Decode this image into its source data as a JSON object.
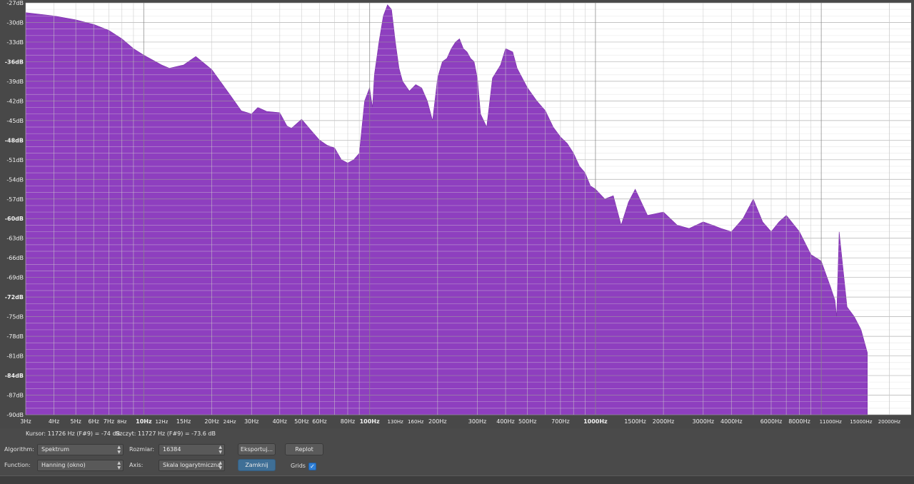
{
  "plot": {
    "db_labels": [
      "-27dB",
      "-30dB",
      "-33dB",
      "-36dB",
      "-39dB",
      "-42dB",
      "-45dB",
      "-48dB",
      "-51dB",
      "-54dB",
      "-57dB",
      "-60dB",
      "-63dB",
      "-66dB",
      "-69dB",
      "-72dB",
      "-75dB",
      "-78dB",
      "-81dB",
      "-84dB",
      "-87dB",
      "-90dB"
    ],
    "freq_labels": [
      "3Hz",
      "4Hz",
      "5Hz",
      "6Hz",
      "7Hz",
      "8Hz",
      "10Hz",
      "12Hz",
      "15Hz",
      "20Hz",
      "24Hz",
      "30Hz",
      "40Hz",
      "50Hz",
      "60Hz",
      "80Hz",
      "100Hz",
      "130Hz",
      "160Hz",
      "200Hz",
      "300Hz",
      "400Hz",
      "500Hz",
      "700Hz",
      "1000Hz",
      "1500Hz",
      "2000Hz",
      "3000Hz",
      "4000Hz",
      "6000Hz",
      "8000Hz",
      "11000Hz",
      "15000Hz",
      "20000Hz"
    ],
    "fill_color": "#8e3fbf",
    "background": "#ffffff"
  },
  "chart_data": {
    "type": "area",
    "x_scale": "log",
    "xlim": [
      3,
      25000
    ],
    "ylim": [
      -90,
      -27
    ],
    "grid": true,
    "xlabel": "",
    "ylabel": "",
    "x": [
      3,
      4,
      5,
      6,
      7,
      8,
      9,
      10,
      12,
      13,
      15,
      17,
      20,
      24,
      27,
      30,
      32,
      35,
      40,
      43,
      45,
      50,
      55,
      60,
      65,
      70,
      75,
      80,
      85,
      90,
      95,
      100,
      103,
      105,
      108,
      110,
      115,
      120,
      125,
      130,
      135,
      140,
      150,
      160,
      170,
      180,
      190,
      200,
      210,
      220,
      230,
      240,
      250,
      260,
      270,
      280,
      290,
      300,
      310,
      330,
      350,
      380,
      400,
      430,
      450,
      500,
      550,
      600,
      650,
      700,
      750,
      800,
      850,
      900,
      950,
      1000,
      1100,
      1200,
      1300,
      1400,
      1500,
      1700,
      2000,
      2300,
      2600,
      3000,
      3300,
      3600,
      4000,
      4500,
      5000,
      5500,
      6000,
      6500,
      7000,
      8000,
      9000,
      10000,
      11000,
      11500,
      11700,
      12000,
      13000,
      14000,
      15000,
      16000
    ],
    "y": [
      -28.5,
      -29.0,
      -29.6,
      -30.3,
      -31.2,
      -32.5,
      -34.0,
      -35.0,
      -36.5,
      -37.0,
      -36.5,
      -35.2,
      -37.2,
      -41.0,
      -43.5,
      -44.0,
      -43.0,
      -43.6,
      -43.8,
      -45.8,
      -46.2,
      -44.8,
      -46.5,
      -48.0,
      -48.8,
      -49.2,
      -51.0,
      -51.5,
      -51.0,
      -50.0,
      -42.0,
      -40.0,
      -43.0,
      -38.0,
      -35.0,
      -33.0,
      -29.0,
      -27.3,
      -28.0,
      -33.0,
      -37.0,
      -39.0,
      -40.5,
      -39.5,
      -40.0,
      -42.0,
      -45.0,
      -38.5,
      -36.0,
      -35.5,
      -34.0,
      -33.0,
      -32.5,
      -34.0,
      -34.5,
      -35.5,
      -36.0,
      -38.5,
      -44.0,
      -46.0,
      -38.5,
      -36.5,
      -34.0,
      -34.5,
      -37.0,
      -40.0,
      -42.0,
      -43.5,
      -46.0,
      -47.5,
      -48.5,
      -50.0,
      -52.0,
      -53.0,
      -55.0,
      -55.5,
      -57.0,
      -56.5,
      -61.0,
      -57.5,
      -55.5,
      -59.5,
      -59.0,
      -61.0,
      -61.5,
      -60.5,
      -61.0,
      -61.5,
      -62.0,
      -60.0,
      -57.0,
      -60.5,
      -62.0,
      -60.5,
      -59.5,
      -62.0,
      -65.5,
      -66.5,
      -70.5,
      -72.5,
      -75.0,
      -62.0,
      -73.5,
      -75.0,
      -77.0,
      -80.5,
      -81.0,
      -82.0
    ]
  },
  "status": {
    "cursor_text": "Kursor: 11726 Hz (F#9) = -74 dB",
    "peak_text": "Szczyt: 11727 Hz (F#9) = -73.6 dB"
  },
  "controls": {
    "algorithm_label": "Algorithm:",
    "algorithm_value": "Spektrum",
    "size_label": "Rozmiar:",
    "size_value": "16384",
    "export_button": "Eksportuj...",
    "replot_button": "Replot",
    "function_label": "Function:",
    "function_value": "Hanning (okno)",
    "axis_label": "Axis:",
    "axis_value": "Skala logarytmiczna",
    "close_button": "Zamknij",
    "grids_label": "Grids",
    "grids_checked": true
  }
}
